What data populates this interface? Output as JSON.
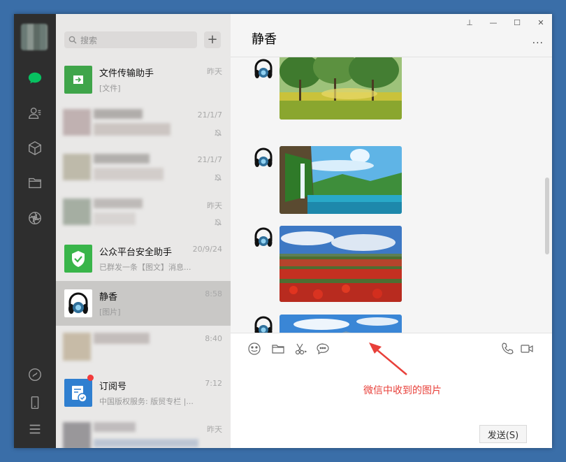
{
  "sidebar": {
    "icons": [
      "chat-icon",
      "contacts-icon",
      "favorites-icon",
      "files-icon",
      "moments-icon",
      "mini-program-icon",
      "phone-icon",
      "menu-icon"
    ],
    "accent": "#07c160"
  },
  "search": {
    "placeholder": "搜索",
    "add_label": "+"
  },
  "chats": [
    {
      "name": "文件传输助手",
      "preview": "[文件]",
      "time": "昨天"
    },
    {
      "name": "",
      "preview": "",
      "time": "21/1/7",
      "muted": true,
      "blurred": true
    },
    {
      "name": "",
      "preview": "",
      "time": "21/1/7",
      "muted": true,
      "blurred": true
    },
    {
      "name": "",
      "preview": "",
      "time": "昨天",
      "muted": true,
      "blurred": true
    },
    {
      "name": "公众平台安全助手",
      "preview": "已群发一条【图文】消息...",
      "time": "20/9/24"
    },
    {
      "name": "静香",
      "preview": "[图片]",
      "time": "8:58",
      "active": true
    },
    {
      "name": "",
      "preview": "",
      "time": "8:40",
      "blurred": true
    },
    {
      "name": "订阅号",
      "preview": "中国版权服务: 版贸专栏 |...",
      "time": "7:12",
      "badge": true
    },
    {
      "name": "",
      "preview": "",
      "time": "昨天",
      "blurred": true
    }
  ],
  "chat": {
    "title": "静香",
    "more": "...",
    "window_controls": [
      "pin-icon",
      "minimize-icon",
      "maximize-icon",
      "close-icon"
    ],
    "messages": [
      {
        "type": "image",
        "scene": "forest-sunlight"
      },
      {
        "type": "image",
        "scene": "waterfall-lake"
      },
      {
        "type": "image",
        "scene": "poppy-field"
      },
      {
        "type": "image",
        "scene": "mountain-sky"
      }
    ]
  },
  "composer": {
    "tools": [
      "emoji-icon",
      "folder-icon",
      "scissors-icon",
      "speech-bubble-icon"
    ],
    "right_tools": [
      "phone-call-icon",
      "video-call-icon"
    ],
    "send_label": "发送(S)"
  },
  "annotation": {
    "text": "微信中收到的图片",
    "color": "#e8403a"
  }
}
